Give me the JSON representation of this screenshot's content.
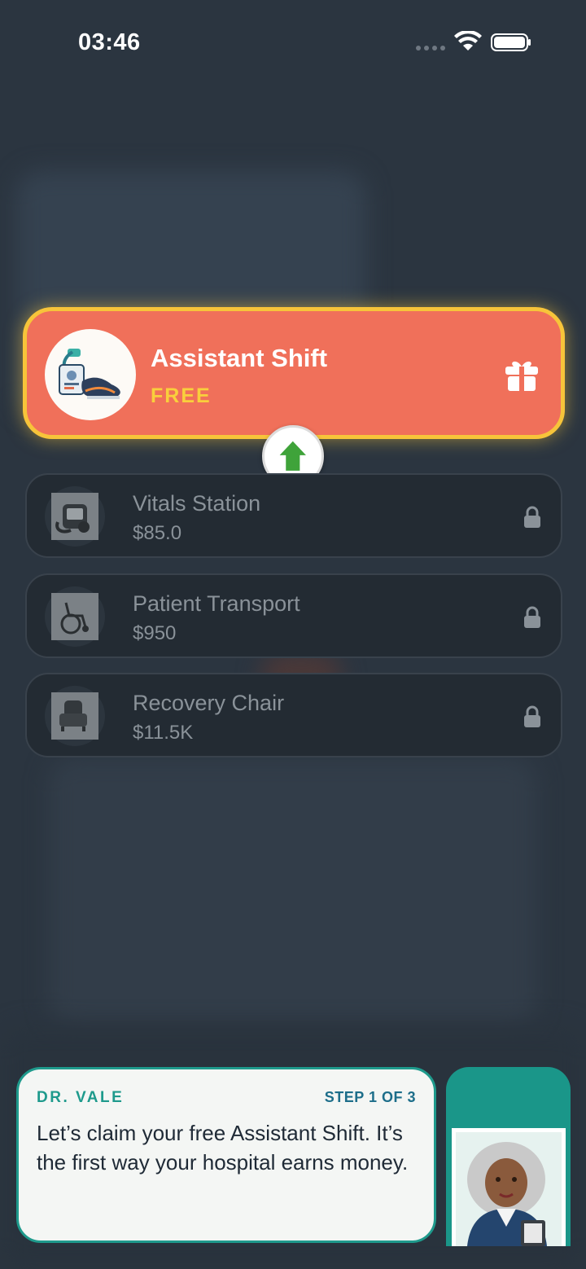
{
  "status_bar": {
    "time": "03:46"
  },
  "featured_item": {
    "name": "Assistant Shift",
    "price": "FREE"
  },
  "items": [
    {
      "name": "Vitals Station",
      "price": "$85.0"
    },
    {
      "name": "Patient Transport",
      "price": "$950"
    },
    {
      "name": "Recovery Chair",
      "price": "$11.5K"
    }
  ],
  "dialog": {
    "speaker": "DR. VALE",
    "step": "STEP 1 OF 3",
    "message": "Let’s claim your free Assistant Shift. It’s the first way your hospital earns money."
  },
  "colors": {
    "featured_bg": "#f0705a",
    "featured_border": "#f7c43a",
    "accent_teal": "#1e9a8c",
    "arrow_green": "#3fa33a"
  },
  "icons": [
    "wifi-icon",
    "battery-icon",
    "gift-icon",
    "arrow-up-icon",
    "lock-icon"
  ]
}
